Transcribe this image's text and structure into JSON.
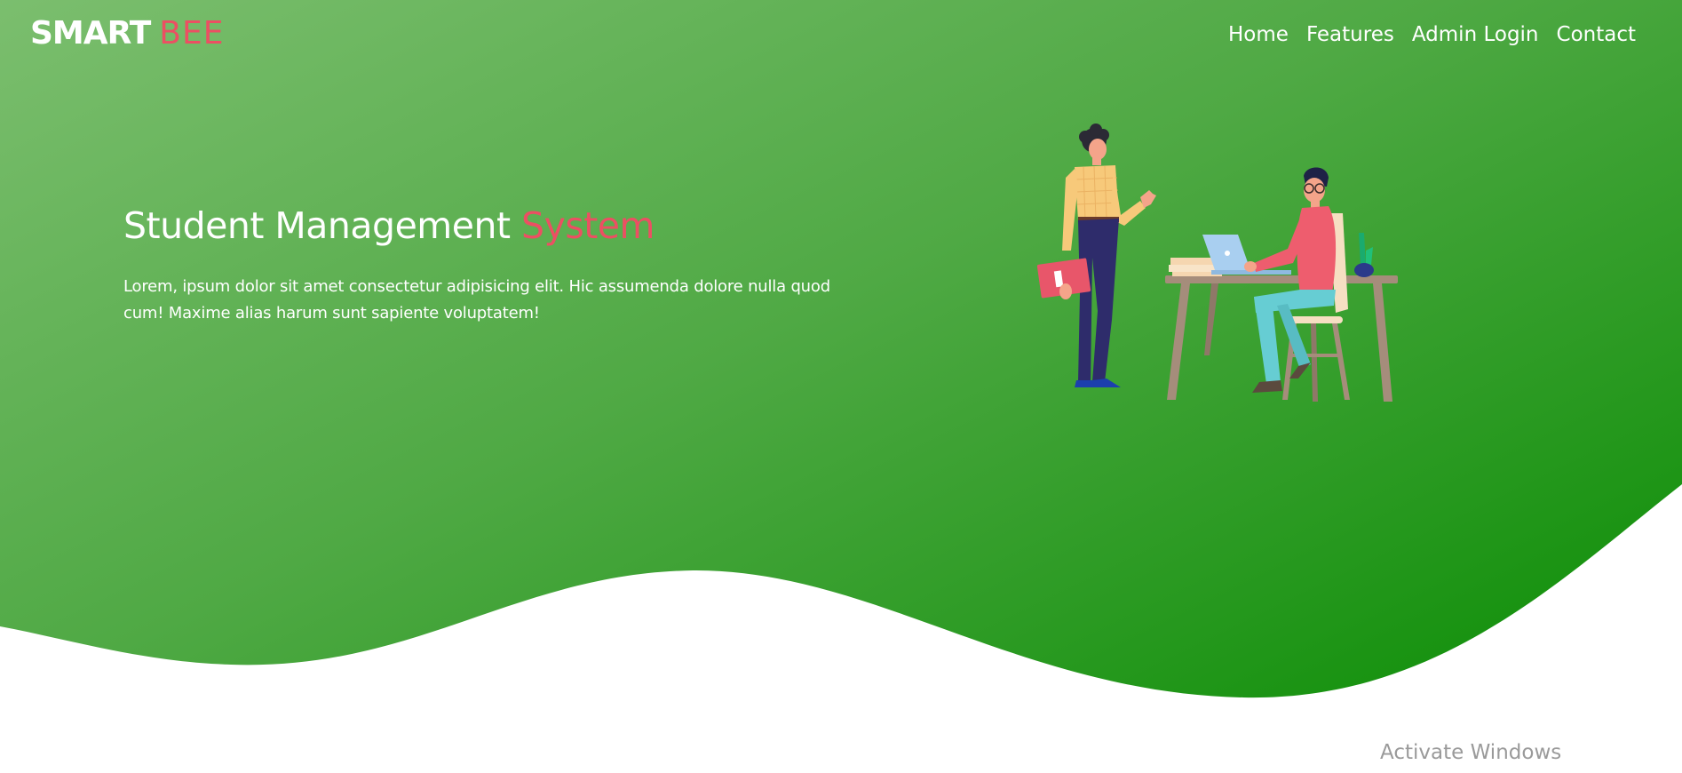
{
  "brand": {
    "first": "SMART",
    "second": "BEE"
  },
  "nav": {
    "items": [
      {
        "label": "Home"
      },
      {
        "label": "Features"
      },
      {
        "label": "Admin Login"
      },
      {
        "label": "Contact"
      }
    ]
  },
  "hero": {
    "title_main": "Student Management ",
    "title_accent": "System",
    "text": "Lorem, ipsum dolor sit amet consectetur adipisicing elit. Hic assumenda dolore nulla quod cum! Maxime alias harum sunt sapiente voluptatem!"
  },
  "illustration": {
    "icon": "office-people-illustration"
  },
  "watermark": {
    "text": "Activate Windows"
  },
  "colors": {
    "hero_gradient_start": "#79bd6d",
    "hero_gradient_end": "#1a9413",
    "accent": "#ec4f63",
    "text_on_hero": "#ffffff",
    "watermark": "#9a9a9a"
  }
}
